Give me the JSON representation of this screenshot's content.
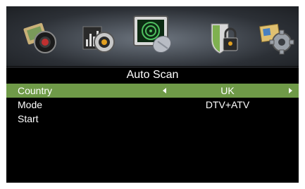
{
  "menu_icons": [
    {
      "name": "picture-icon"
    },
    {
      "name": "sound-icon"
    },
    {
      "name": "channel-icon",
      "active": true
    },
    {
      "name": "lock-icon"
    },
    {
      "name": "setup-icon"
    }
  ],
  "title": "Auto Scan",
  "items": [
    {
      "label": "Country",
      "value": "UK",
      "selected": true
    },
    {
      "label": "Mode",
      "value": "DTV+ATV",
      "selected": false
    },
    {
      "label": "Start",
      "value": "",
      "selected": false
    }
  ],
  "colors": {
    "selected_row": "#6f9a48",
    "background": "#000000",
    "text": "#ffffff"
  }
}
